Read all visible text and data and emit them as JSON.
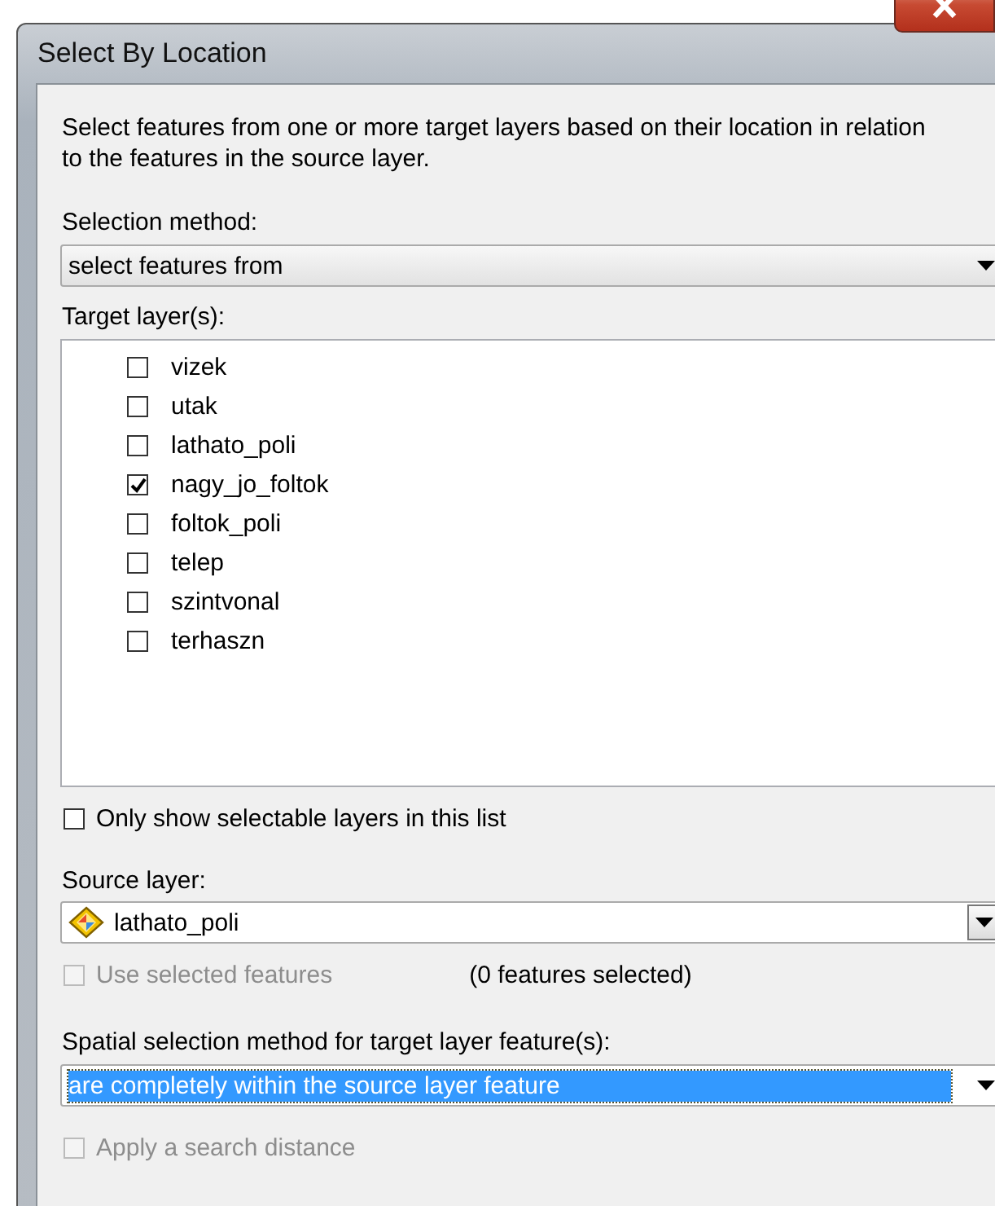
{
  "window": {
    "title": "Select By Location"
  },
  "description": "Select features from one or more target layers based on their location in relation to the features in the source layer.",
  "selection_method": {
    "label": "Selection method:",
    "value": "select features from"
  },
  "target_layers": {
    "label": "Target layer(s):",
    "items": [
      {
        "name": "vizek",
        "checked": false
      },
      {
        "name": "utak",
        "checked": false
      },
      {
        "name": "lathato_poli",
        "checked": false
      },
      {
        "name": "nagy_jo_foltok",
        "checked": true
      },
      {
        "name": "foltok_poli",
        "checked": false
      },
      {
        "name": "telep",
        "checked": false
      },
      {
        "name": "szintvonal",
        "checked": false
      },
      {
        "name": "terhaszn",
        "checked": false
      }
    ]
  },
  "only_selectable": {
    "label": "Only show selectable layers in this list",
    "checked": false,
    "disabled": false
  },
  "source_layer": {
    "label": "Source layer:",
    "value": "lathato_poli"
  },
  "use_selected": {
    "label": "Use selected features",
    "checked": false,
    "disabled": true
  },
  "features_selected": "(0 features selected)",
  "spatial_method": {
    "label": "Spatial selection method for target layer feature(s):",
    "value": "are completely within the source layer feature",
    "selected": true
  },
  "search_distance": {
    "label": "Apply a search distance",
    "checked": false,
    "disabled": true
  }
}
